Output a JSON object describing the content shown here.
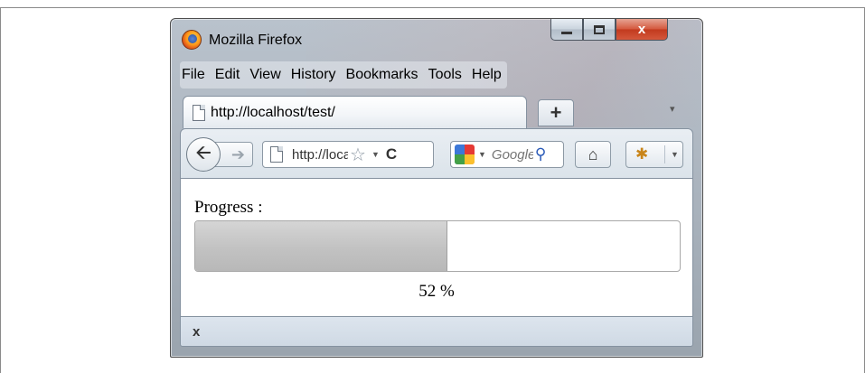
{
  "window": {
    "title": "Mozilla Firefox",
    "caption_buttons": {
      "close_label": "x"
    }
  },
  "menubar": {
    "items": [
      {
        "label": "File"
      },
      {
        "label": "Edit"
      },
      {
        "label": "View"
      },
      {
        "label": "History"
      },
      {
        "label": "Bookmarks"
      },
      {
        "label": "Tools"
      },
      {
        "label": "Help"
      }
    ]
  },
  "tabs": {
    "active_tab_label": "http://localhost/test/",
    "new_tab_label": "+"
  },
  "navbar": {
    "url_value": "http://localhost/test/",
    "search_value": "Google",
    "icons": {
      "back": "arrow-left-icon",
      "forward": "arrow-right-icon",
      "bookmark": "star-icon",
      "reload": "reload-icon",
      "search_engine": "google-icon",
      "search": "search-icon",
      "home": "home-icon",
      "addon": "bug-icon"
    }
  },
  "page": {
    "progress_label": "Progress :",
    "progress_value_text": "52 %",
    "progress_fraction": 0.52
  },
  "statusbar": {
    "close_label": "x"
  }
}
